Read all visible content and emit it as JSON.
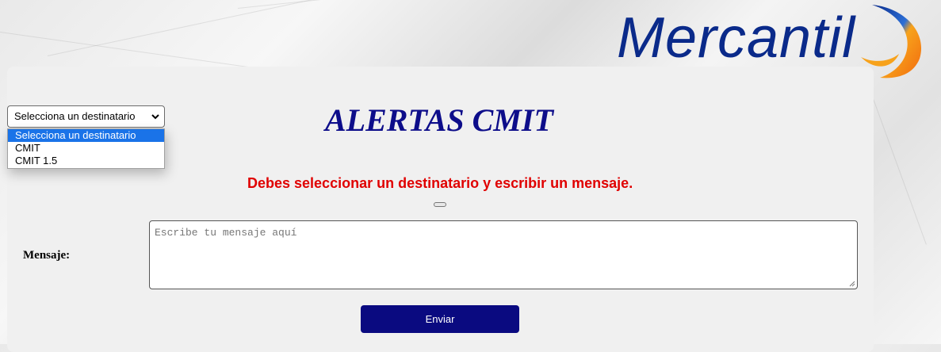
{
  "logo": {
    "text": "Mercantil"
  },
  "recipient_select": {
    "selected": "Selecciona un destinatario",
    "options": [
      "Selecciona un destinatario",
      "CMIT",
      "CMIT 1.5"
    ]
  },
  "page": {
    "title": "ALERTAS CMIT",
    "error_message": "Debes seleccionar un destinatario y escribir un mensaje."
  },
  "form": {
    "message_label": "Mensaje:",
    "message_placeholder": "Escribe tu mensaje aquí",
    "message_value": "",
    "send_label": "Enviar"
  },
  "colors": {
    "brand_blue": "#0a2a8a",
    "title_blue": "#0d0d8a",
    "button_navy": "#0a0a80",
    "error_red": "#e00000",
    "selected_option": "#1a73e8"
  },
  "icons": {
    "select_arrow": "chevron-down-icon",
    "textarea_grip": "resize-grip-icon"
  }
}
